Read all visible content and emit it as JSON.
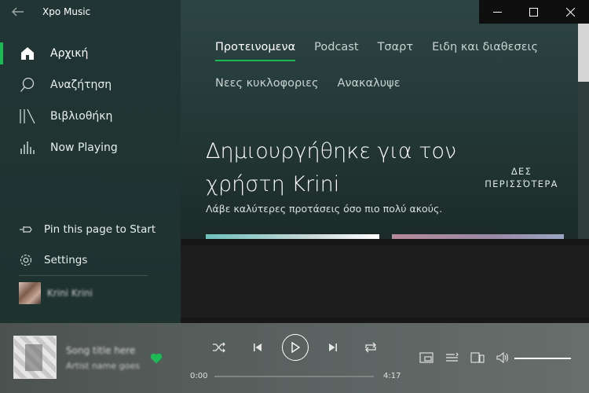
{
  "app": {
    "title": "Xpo Music"
  },
  "sidebar": {
    "items": [
      {
        "label": "Αρχική",
        "icon": "home-icon",
        "active": true
      },
      {
        "label": "Αναζήτηση",
        "icon": "search-icon",
        "active": false
      },
      {
        "label": "Βιβλιοθήκη",
        "icon": "library-icon",
        "active": false
      },
      {
        "label": "Now Playing",
        "icon": "now-playing-icon",
        "active": false
      }
    ],
    "pin_label": "Pin this page to Start",
    "settings_label": "Settings",
    "user_name": "Krini Krini"
  },
  "main": {
    "tabs": [
      {
        "label": "Προτεινομενα",
        "active": true
      },
      {
        "label": "Podcast",
        "active": false
      },
      {
        "label": "Τσαρτ",
        "active": false
      },
      {
        "label": "Ειδη και διαθεσεις",
        "active": false
      },
      {
        "label": "Νεες κυκλοφοριες",
        "active": false
      },
      {
        "label": "Ανακαλυψε",
        "active": false
      }
    ],
    "section_title": "Δημιουργήθηκε για τον χρήστη Krini",
    "section_subtitle": "Λάβε καλύτερες προτάσεις όσο πιο πολύ ακούς.",
    "see_more_line1": "ΔΕΣ",
    "see_more_line2": "ΠΕΡΙΣΣΌΤΕΡΑ"
  },
  "player": {
    "track_title": "Song title here",
    "artist": "Artist name goes",
    "liked": true,
    "time_current": "0:00",
    "time_total": "4:17",
    "progress": 0,
    "volume": 1.0
  },
  "colors": {
    "accent": "#1db954",
    "sidebar_bg": "#213634",
    "player_bg": "#565e5c"
  }
}
